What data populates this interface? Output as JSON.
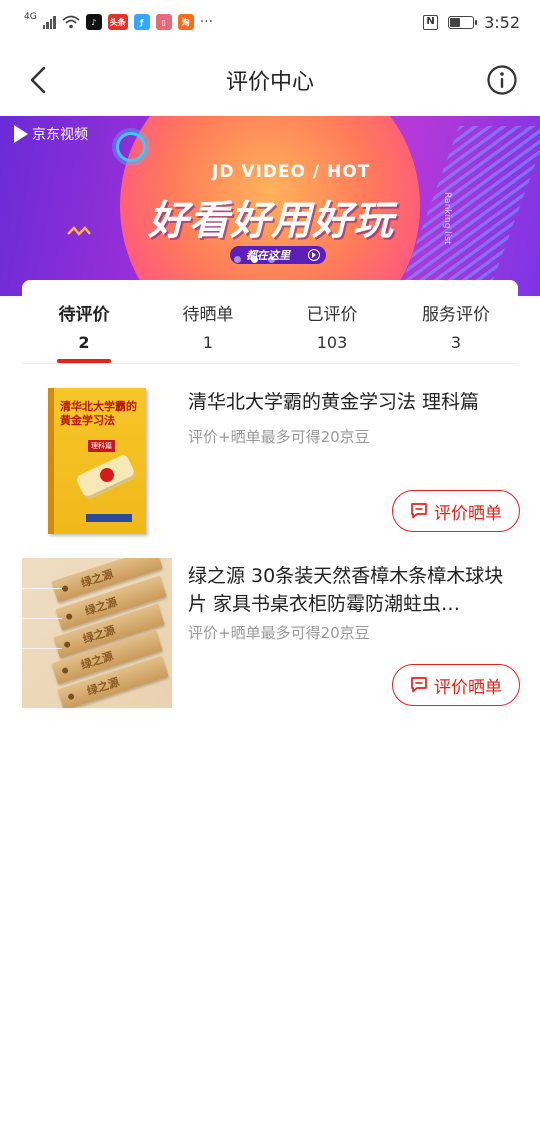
{
  "status": {
    "network": "4G",
    "apps": [
      "tiktok-icon",
      "toutiao-icon",
      "fitness-icon",
      "reader-icon",
      "taobao-icon"
    ],
    "app_labels": [
      "头条",
      "淘"
    ],
    "more": "···",
    "nfc": "N",
    "time": "3:52"
  },
  "nav": {
    "title": "评价中心"
  },
  "banner": {
    "logo": "京东视频",
    "subhead": "JD VIDEO / HOT",
    "headline": "好看好用好玩",
    "pill": "都在这里",
    "side_text": "Ranking list"
  },
  "tabs": [
    {
      "label": "待评价",
      "count": "2",
      "active": true
    },
    {
      "label": "待晒单",
      "count": "1",
      "active": false
    },
    {
      "label": "已评价",
      "count": "103",
      "active": false
    },
    {
      "label": "服务评价",
      "count": "3",
      "active": false
    }
  ],
  "products": [
    {
      "title": "清华北大学霸的黄金学习法 理科篇",
      "subtitle": "评价+晒单最多可得20京豆",
      "button": "评价晒单",
      "cover_title": "清华北大学霸的黄金学习法",
      "cover_tag": "理科篇"
    },
    {
      "title": "绿之源 30条装天然香樟木条樟木球块片 家具书桌衣柜防霉防潮蛀虫…",
      "subtitle": "评价+晒单最多可得20京豆",
      "button": "评价晒单",
      "brand": "绿之源"
    }
  ],
  "colors": {
    "accent": "#e2231a"
  }
}
